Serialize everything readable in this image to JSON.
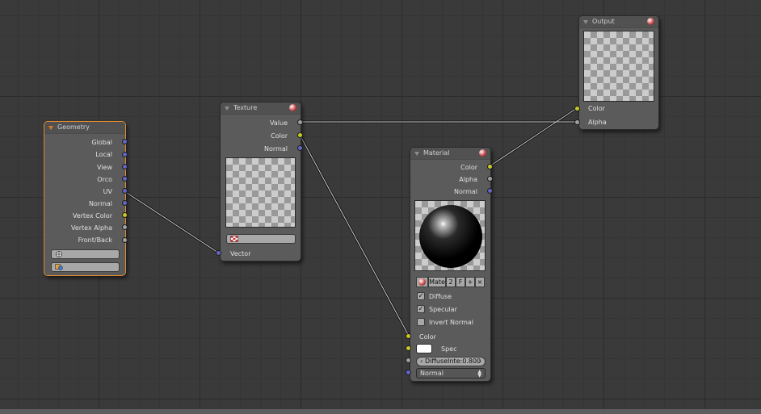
{
  "colors": {
    "selected_outline": "#e28a2e",
    "vector_socket": "#6464c8",
    "color_socket": "#c8c829",
    "value_socket": "#a1a1a1"
  },
  "nodes": {
    "geometry": {
      "title": "Geometry",
      "outputs": [
        "Global",
        "Local",
        "View",
        "Orco",
        "UV",
        "Normal",
        "Vertex Color",
        "Vertex Alpha",
        "Front/Back"
      ],
      "icons": [
        "uv-layer-icon",
        "vertex-color-icon"
      ]
    },
    "texture": {
      "title": "Texture",
      "outputs": [
        "Value",
        "Color",
        "Normal"
      ],
      "input": "Vector",
      "texture_icon": "texture-icon"
    },
    "material": {
      "title": "Material",
      "outputs": [
        "Color",
        "Alpha",
        "Normal"
      ],
      "mat_name": "Mate",
      "mat_users": "2",
      "mat_fake": "F",
      "checkboxes": [
        {
          "label": "Diffuse",
          "checked": true
        },
        {
          "label": "Specular",
          "checked": true
        },
        {
          "label": "Invert Normal",
          "checked": false
        }
      ],
      "inputs": {
        "color": "Color",
        "spec": "Spec",
        "diffuse_intensity": "DiffuseInte:0.800",
        "normal": "Normal"
      }
    },
    "output": {
      "title": "Output",
      "inputs": [
        "Color",
        "Alpha"
      ]
    }
  }
}
